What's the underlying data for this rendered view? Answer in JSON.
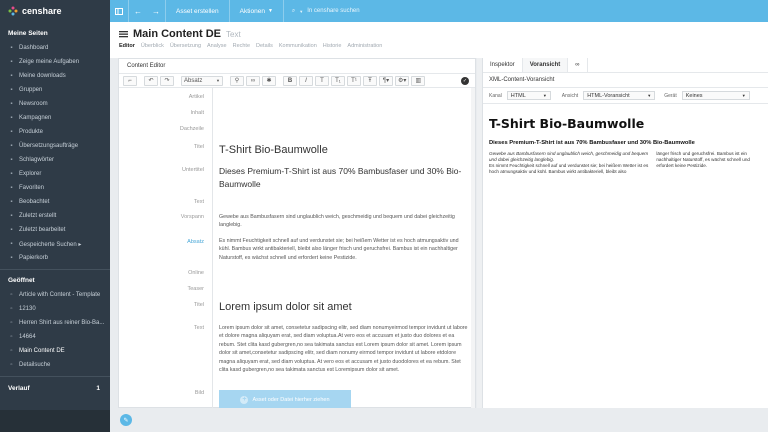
{
  "app": {
    "brand": "censhare"
  },
  "topbar": {
    "create_asset": "Asset erstellen",
    "actions": "Aktionen",
    "search_placeholder": "In censhare suchen"
  },
  "sidebar": {
    "my_pages_title": "Meine Seiten",
    "items": [
      {
        "label": "Dashboard",
        "icon": "dashboard-icon"
      },
      {
        "label": "Zeige meine Aufgaben",
        "icon": "tasks-icon"
      },
      {
        "label": "Meine downloads",
        "icon": "download-icon"
      },
      {
        "label": "Gruppen",
        "icon": "groups-icon"
      },
      {
        "label": "Newsroom",
        "icon": "newsroom-icon"
      },
      {
        "label": "Kampagnen",
        "icon": "campaign-icon"
      },
      {
        "label": "Produkte",
        "icon": "product-icon"
      },
      {
        "label": "Übersetzungsaufträge",
        "icon": "translation-icon"
      },
      {
        "label": "Schlagwörter",
        "icon": "tag-icon"
      },
      {
        "label": "Explorer",
        "icon": "explorer-icon"
      },
      {
        "label": "Favoriten",
        "icon": "star-icon"
      },
      {
        "label": "Beobachtet",
        "icon": "eye-icon"
      },
      {
        "label": "Zuletzt erstellt",
        "icon": "clock-icon"
      },
      {
        "label": "Zuletzt bearbeitet",
        "icon": "edit-icon"
      },
      {
        "label": "Gespeicherte Suchen ▸",
        "icon": "saved-search-icon"
      },
      {
        "label": "Papierkorb",
        "icon": "trash-icon"
      }
    ],
    "opened_title": "Geöffnet",
    "opened": [
      {
        "label": "Article with Content - Template"
      },
      {
        "label": "12130"
      },
      {
        "label": "Herren Shirt aus reiner Bio-Ba..."
      },
      {
        "label": "14664"
      },
      {
        "label": "Main Content DE"
      },
      {
        "label": "Detailsuche"
      }
    ],
    "history_title": "Verlauf",
    "history_count": "1"
  },
  "header": {
    "title": "Main Content DE",
    "subtitle": "Text",
    "tabs": [
      "Editor",
      "Überblick",
      "Übersetzung",
      "Analyse",
      "Rechte",
      "Details",
      "Kommunikation",
      "Historie",
      "Administration"
    ]
  },
  "editor": {
    "panel_title": "Content Editor",
    "paragraph_select": "Absatz",
    "labels": {
      "artikel": "Artikel",
      "inhalt": "Inhalt",
      "dachzeile": "Dachzeile",
      "titel": "Titel",
      "untertitel": "Untertitel",
      "text": "Text",
      "vorspann": "Vorspann",
      "absatz": "Absatz",
      "online": "Online",
      "teaser": "Teaser",
      "titel2": "Titel",
      "text2": "Text",
      "bild": "Bild"
    },
    "content": {
      "title": "T-Shirt Bio-Baumwolle",
      "subtitle": "Dieses Premium-T-Shirt ist aus 70% Bambusfaser und 30% Bio-Baumwolle",
      "vorspann": "Gewebe aus Bambusfasern sind unglaublich weich, geschmeidig und bequem und dabei gleichzeitig langlebig.",
      "absatz": "Es nimmt Feuchtigkeit schnell auf und verdunstet sie; bei heißem Wetter ist es hoch atmungsaktiv und kühl. Bambus wirkt antibakteriell, bleibt also länger frisch und geruchsfrei. Bambus ist ein nachhaltiger Naturstoff, es wächst schnell und erfordert keine Pestizide.",
      "teaser_title": "Lorem ipsum dolor sit amet",
      "teaser_text": "Lorem ipsum dolor sit amet, consetetur sadipscing elitr, sed diam nonumyeirmod tempor invidunt ut labore et dolore magna aliquyam erat, sed diam voluptua.At vero eos et accusam et justo duo dolores et ea rebum. Stet clita kasd gubergren,no sea takimata sanctus est Lorem ipsum dolor sit amet. Lorem ipsum dolor sit amet,consetetur sadipscing elitr, sed diam nonumy eirmod tempor invidunt ut labore etdolore magna aliquyam erat, sed diam voluptua. At vero eos et accusam et justo duodolores et ea rebum. Stet clita kasd gubergren,no sea takimata sanctus est Loremipsum dolor sit amet.",
      "drop_label": "Asset oder Datei hierher ziehen"
    }
  },
  "preview": {
    "tabs": [
      "Inspektor",
      "Voransicht"
    ],
    "panel_title": "XML-Content-Voransicht",
    "kanal_label": "Kanal",
    "kanal_value": "HTML",
    "ansicht_label": "Ansicht",
    "ansicht_value": "HTML-Voransicht",
    "geraet_label": "Gerät",
    "geraet_value": "Keines",
    "h1": "T-Shirt Bio-Baumwolle",
    "h2": "Dieses Premium-T-Shirt ist aus 70% Bambusfaser und 30% Bio-Baumwolle",
    "col1_italic": "Gewebe aus Bambusfasern sind unglaublich weich, geschmeidig und bequem und dabei gleichzeitig langlebig.",
    "col1_text": "Es nimmt Feuchtigkeit schnell auf und verdunstet sie; bei heißem Wetter ist es hoch atmungsaktiv und kühl. Bambus wirkt antibakteriell, bleibt also",
    "col2_text": "länger frisch und geruchsfrei. Bambus ist ein nachhaltiger Naturstoff, es wächst schnell und erfordert keine Pestizide."
  }
}
